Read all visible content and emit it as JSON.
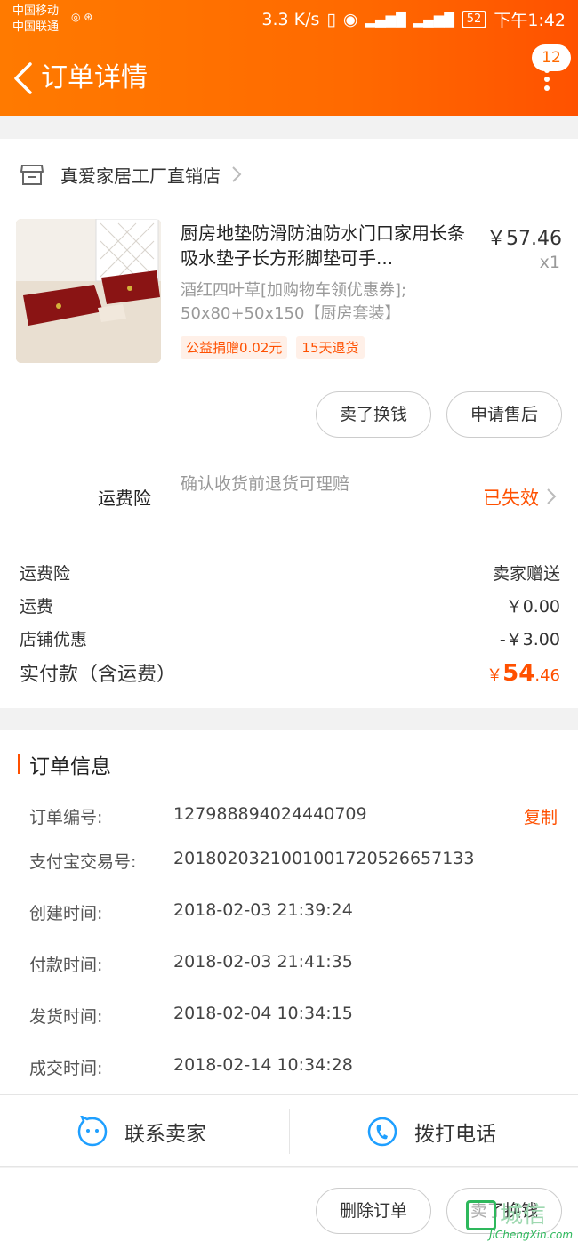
{
  "status_bar": {
    "carrier1": "中国移动",
    "carrier2": "中国联通",
    "speed": "3.3 K/s",
    "battery": "52",
    "time": "下午1:42"
  },
  "header": {
    "title": "订单详情",
    "message_count": "12"
  },
  "store": {
    "name": "真爱家居工厂直销店"
  },
  "product": {
    "title": "厨房地垫防滑防油防水门口家用长条吸水垫子长方形脚垫可手...",
    "price": "￥57.46",
    "quantity": "x1",
    "sku": "酒红四叶草[加购物车领优惠券]; 50x80+50x150【厨房套装】",
    "tags": [
      "公益捐赠0.02元",
      "15天退货"
    ]
  },
  "item_actions": {
    "sell": "卖了换钱",
    "after_sale": "申请售后"
  },
  "shipping_insurance": {
    "label": "运费险",
    "desc": "确认收货前退货可理赔",
    "status": "已失效"
  },
  "fees": [
    {
      "label": "运费险",
      "value": "卖家赠送"
    },
    {
      "label": "运费",
      "value": "￥0.00"
    },
    {
      "label": "店铺优惠",
      "value": "-￥3.00"
    }
  ],
  "total": {
    "label": "实付款（含运费）",
    "currency": "￥",
    "integer": "54",
    "decimal": ".46"
  },
  "order_info": {
    "title": "订单信息",
    "copy_label": "复制",
    "rows": [
      {
        "label": "订单编号:",
        "value": "127988894024440709"
      },
      {
        "label": "支付宝交易号:",
        "value": "2018020321001001720526657133"
      },
      {
        "label": "创建时间:",
        "value": "2018-02-03 21:39:24"
      },
      {
        "label": "付款时间:",
        "value": "2018-02-03 21:41:35"
      },
      {
        "label": "发货时间:",
        "value": "2018-02-04 10:34:15"
      },
      {
        "label": "成交时间:",
        "value": "2018-02-14 10:34:28"
      }
    ]
  },
  "contact": {
    "seller": "联系卖家",
    "phone": "拨打电话"
  },
  "bottom_actions": {
    "delete": "删除订单",
    "sell": "卖了换钱"
  },
  "watermark": {
    "text": "城信",
    "sub": "JiChengXin.com"
  },
  "colors": {
    "brand": "#ff6a00",
    "accent": "#ff5000"
  }
}
